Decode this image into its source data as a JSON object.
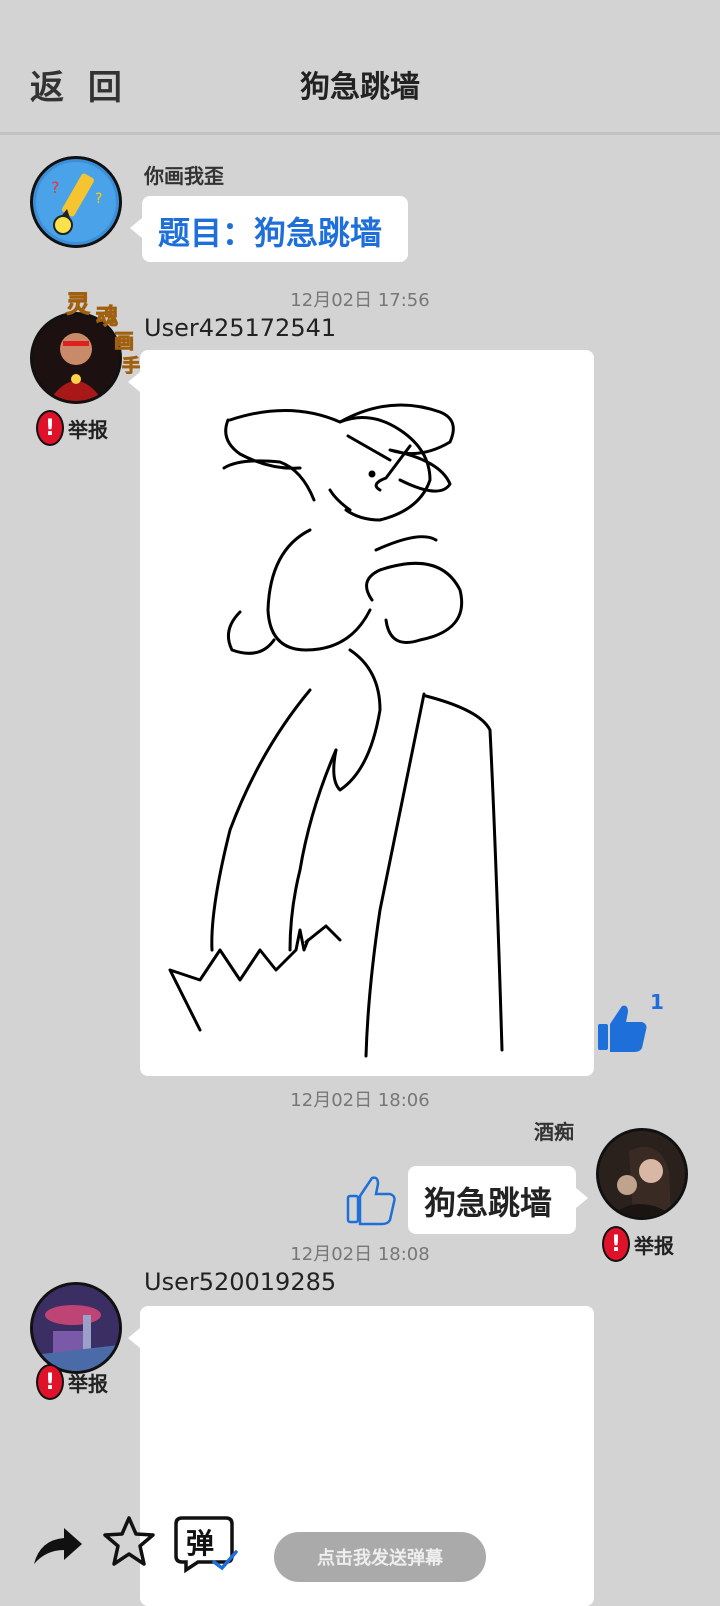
{
  "header": {
    "back_label": "返 回",
    "title": "狗急跳墙"
  },
  "messages": [
    {
      "sender": "你画我歪",
      "text": "题目：狗急跳墙"
    },
    {
      "timestamp": "12月02日  17:56",
      "sender": "User425172541",
      "avatar_badge": "灵魂画手",
      "report_label": "举报",
      "like_count": "1"
    },
    {
      "timestamp": "12月02日  18:06",
      "sender": "酒痴",
      "text": "狗急跳墙",
      "report_label": "举报"
    },
    {
      "timestamp": "12月02日  18:08",
      "sender": "User520019285",
      "report_label": "举报"
    }
  ],
  "bottom_bar": {
    "danmu_label": "弹",
    "danmu_placeholder": "点击我发送弹幕"
  },
  "colors": {
    "accent_blue": "#1e6fd9",
    "background": "#d3d3d3",
    "report_red": "#e0122a"
  },
  "icons": [
    "share-icon",
    "star-icon",
    "danmu-icon",
    "thumbs-up-icon",
    "exclamation-icon"
  ]
}
